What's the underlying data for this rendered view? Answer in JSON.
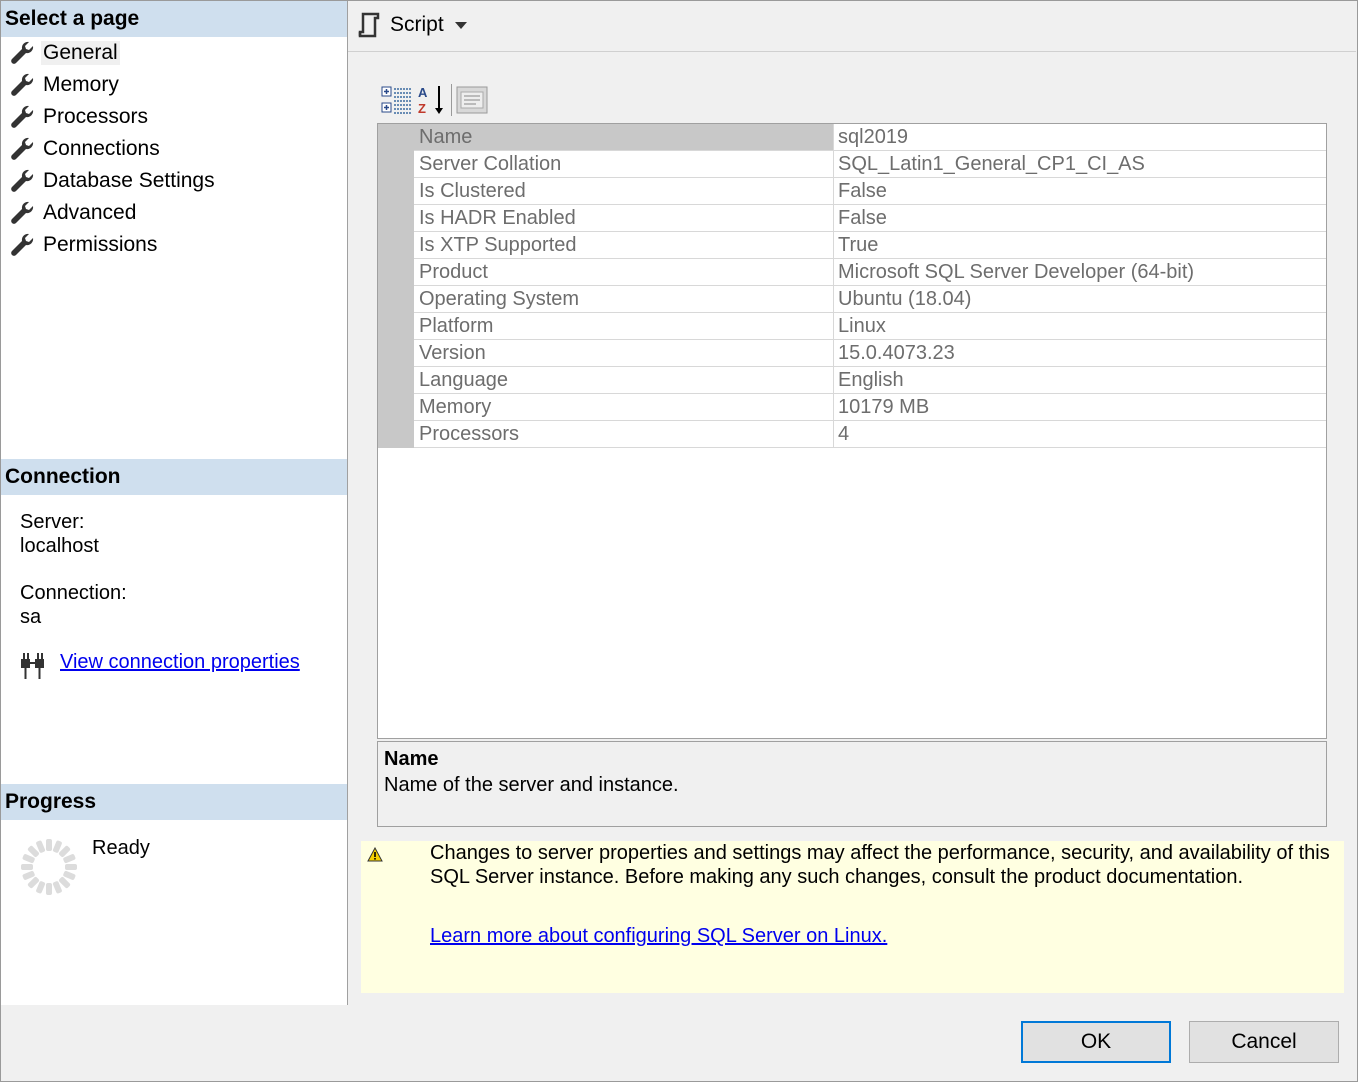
{
  "left": {
    "select_page_header": "Select a page",
    "pages": [
      {
        "label": "General",
        "selected": true
      },
      {
        "label": "Memory",
        "selected": false
      },
      {
        "label": "Processors",
        "selected": false
      },
      {
        "label": "Connections",
        "selected": false
      },
      {
        "label": "Database Settings",
        "selected": false
      },
      {
        "label": "Advanced",
        "selected": false
      },
      {
        "label": "Permissions",
        "selected": false
      }
    ],
    "connection_header": "Connection",
    "server_label": "Server:",
    "server_value": "localhost",
    "connection_label": "Connection:",
    "connection_value": "sa",
    "view_connection_properties": "View connection properties",
    "progress_header": "Progress",
    "progress_status": "Ready"
  },
  "toolbar": {
    "script_label": "Script"
  },
  "properties": {
    "rows": [
      {
        "name": "Name",
        "value": "sql2019",
        "selected": true
      },
      {
        "name": "Server Collation",
        "value": "SQL_Latin1_General_CP1_CI_AS"
      },
      {
        "name": "Is Clustered",
        "value": "False"
      },
      {
        "name": "Is HADR Enabled",
        "value": "False"
      },
      {
        "name": "Is XTP Supported",
        "value": "True"
      },
      {
        "name": "Product",
        "value": "Microsoft SQL Server Developer (64-bit)"
      },
      {
        "name": "Operating System",
        "value": "Ubuntu (18.04)"
      },
      {
        "name": "Platform",
        "value": "Linux"
      },
      {
        "name": "Version",
        "value": "15.0.4073.23"
      },
      {
        "name": "Language",
        "value": "English"
      },
      {
        "name": "Memory",
        "value": "10179 MB"
      },
      {
        "name": "Processors",
        "value": "4"
      }
    ],
    "description_title": "Name",
    "description_text": "Name of the server and instance."
  },
  "warning": {
    "text": "Changes to server properties and settings may affect the performance, security, and availability of this SQL Server instance. Before making any such changes, consult the product documentation.",
    "link": "Learn more about configuring SQL Server on Linux."
  },
  "buttons": {
    "ok": "OK",
    "cancel": "Cancel"
  },
  "colors": {
    "section_header_bg": "#cfdfee",
    "warning_bg": "#ffffe1",
    "link": "#0000ee",
    "ok_border": "#0078d7"
  },
  "icons": [
    "wrench-icon",
    "script-icon",
    "dropdown-caret-icon",
    "categorized-icon",
    "alphabetical-sort-icon",
    "property-pages-icon",
    "plug-icon",
    "spinner-icon",
    "warning-icon"
  ]
}
